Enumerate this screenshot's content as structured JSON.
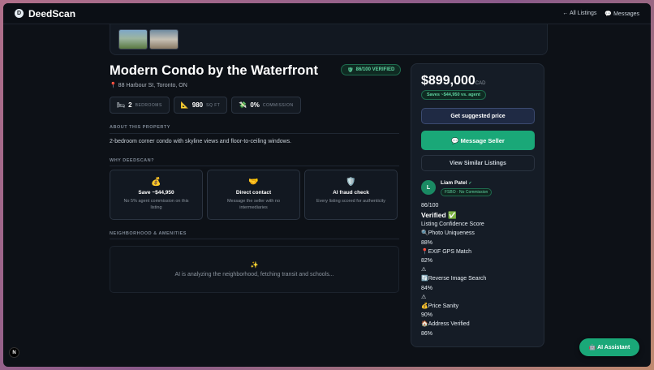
{
  "header": {
    "brand": "DeedScan",
    "brand_logo": "D",
    "nav": [
      {
        "icon": "←",
        "label": "All Listings"
      },
      {
        "icon": "💬",
        "label": "Messages"
      }
    ]
  },
  "listing": {
    "title": "Modern Condo by the Waterfront",
    "verified_badge": "86/100 VERIFIED",
    "address": "88 Harbour St, Toronto, ON",
    "stats": [
      {
        "icon": "🛏",
        "value": "2",
        "unit": "BEDROOMS"
      },
      {
        "icon": "📐",
        "value": "980",
        "unit": "SQ FT"
      },
      {
        "icon": "💸",
        "value": "0%",
        "unit": "COMMISSION"
      }
    ],
    "about_label": "ABOUT THIS PROPERTY",
    "description": "2-bedroom corner condo with skyline views and floor-to-ceiling windows.",
    "why_label": "WHY DEEDSCAN?",
    "why_cards": [
      {
        "icon": "💰",
        "title": "Save ~$44,950",
        "sub": "No 5% agent commission on this listing"
      },
      {
        "icon": "🤝",
        "title": "Direct contact",
        "sub": "Message the seller with no intermediaries"
      },
      {
        "icon": "🛡️",
        "title": "AI fraud check",
        "sub": "Every listing scored for authenticity"
      }
    ],
    "neighborhood_label": "NEIGHBORHOOD & AMENITIES",
    "ai_status": "AI is analyzing the neighborhood, fetching transit and schools..."
  },
  "sidebar": {
    "price": "$899,000",
    "currency": "CAD",
    "savings": "Saves ~$44,950 vs. agent",
    "suggest_button": "Get suggested price",
    "message_button": "💬 Message Seller",
    "similar_button": "View Similar Listings",
    "seller": {
      "initial": "L",
      "name": "Liam Patel",
      "check": "✓",
      "tag": "FSBO · No Commission"
    },
    "score": "86/100",
    "verified_label": "Verified ✅",
    "confidence_label": "Listing Confidence Score",
    "checks": [
      {
        "label": "🔍Photo Uniqueness",
        "value": "88%"
      },
      {
        "label": "📍EXIF GPS Match",
        "value": "82%"
      },
      {
        "label": "⚠",
        "value": ""
      },
      {
        "label": "🔄Reverse Image Search",
        "value": "84%"
      },
      {
        "label": "⚠",
        "value": ""
      },
      {
        "label": "💰Price Sanity",
        "value": "90%"
      },
      {
        "label": "🏠Address Verified",
        "value": "86%"
      }
    ]
  },
  "ai_assistant": "🤖 AI Assistant",
  "next_badge": "N"
}
